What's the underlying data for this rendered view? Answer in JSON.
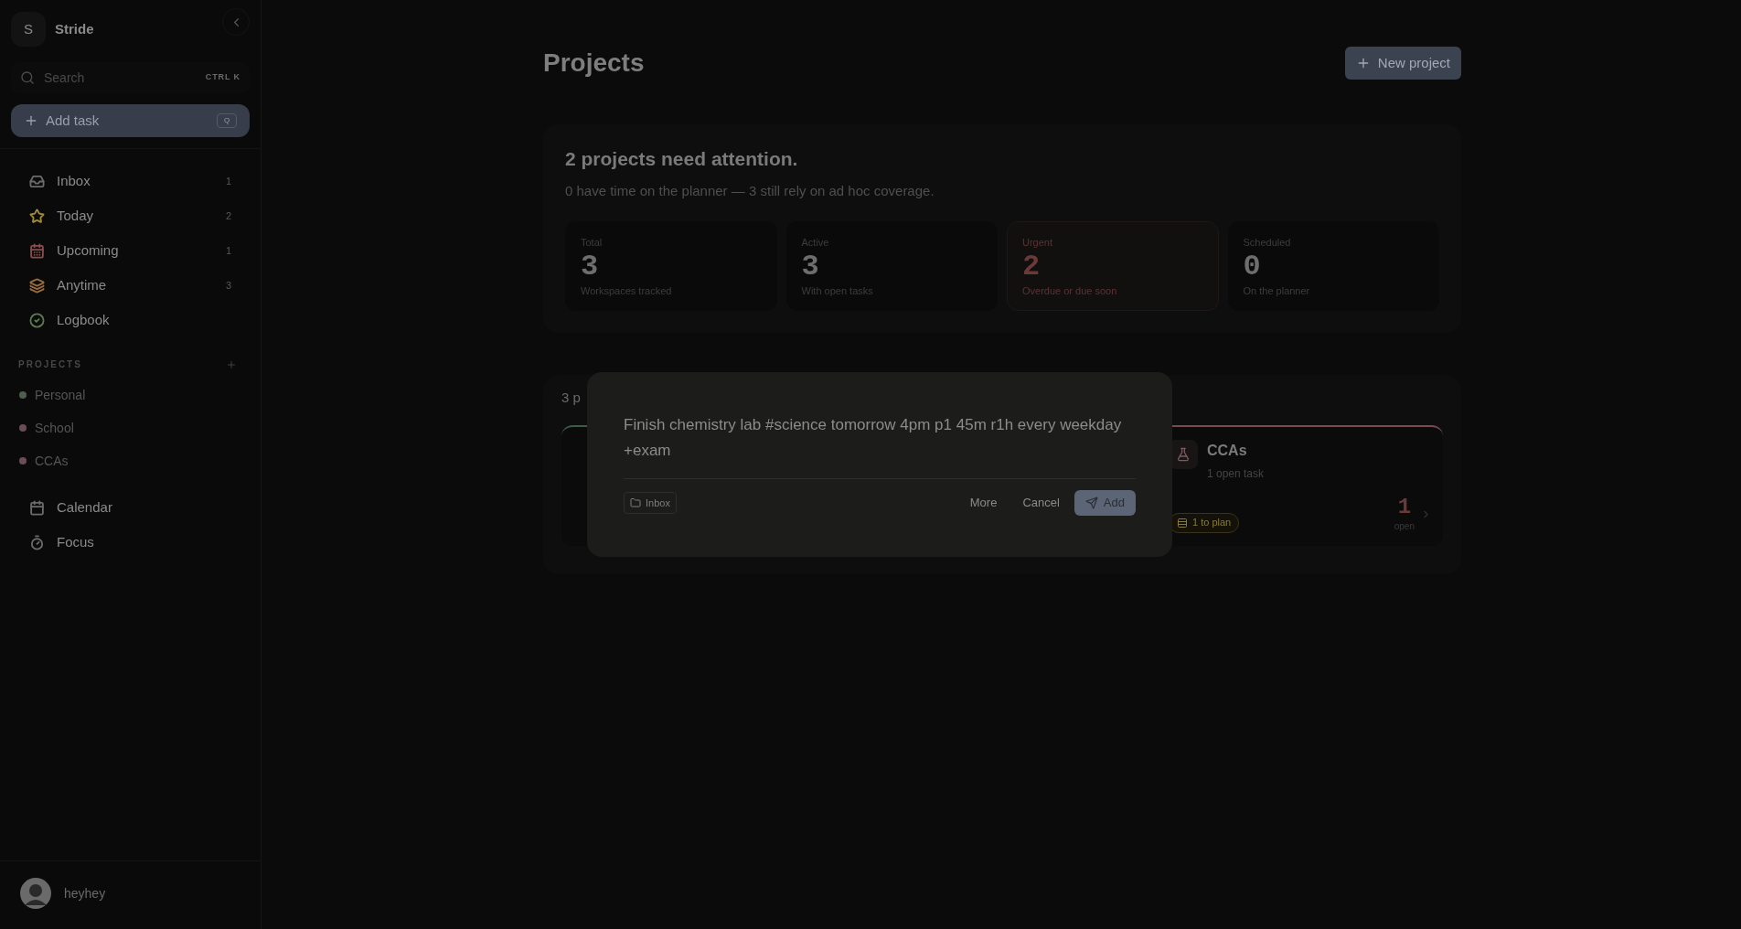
{
  "sidebar": {
    "app_initial": "S",
    "app_name": "Stride",
    "search": {
      "placeholder": "Search",
      "shortcut": "CTRL K"
    },
    "add_task": {
      "label": "Add task",
      "shortcut": "Q"
    },
    "nav": [
      {
        "kind": "inbox",
        "label": "Inbox",
        "count": "1",
        "color": "#6b6b6b"
      },
      {
        "kind": "today",
        "label": "Today",
        "count": "2",
        "color": "#a08a3a"
      },
      {
        "kind": "upcoming",
        "label": "Upcoming",
        "count": "1",
        "color": "#8a4c4c"
      },
      {
        "kind": "anytime",
        "label": "Anytime",
        "count": "3",
        "color": "#9a6a3a"
      },
      {
        "kind": "logbook",
        "label": "Logbook",
        "color": "#5a7a4e"
      }
    ],
    "projects_heading": "PROJECTS",
    "projects": [
      {
        "label": "Personal",
        "color": "#4d5e4f"
      },
      {
        "label": "School",
        "color": "#6b4d55"
      },
      {
        "label": "CCAs",
        "color": "#6b4d55"
      }
    ],
    "tools": [
      {
        "kind": "calendar",
        "label": "Calendar"
      },
      {
        "kind": "focus",
        "label": "Focus"
      }
    ],
    "user": {
      "name": "heyhey"
    }
  },
  "header": {
    "title": "Projects",
    "new_button": "New project"
  },
  "attention": {
    "headline": "2 projects need attention.",
    "subtitle": "0 have time on the planner — 3 still rely on ad hoc coverage.",
    "stats": [
      {
        "label": "Total",
        "value": "3",
        "caption": "Workspaces tracked",
        "urgent": false
      },
      {
        "label": "Active",
        "value": "3",
        "caption": "With open tasks",
        "urgent": false
      },
      {
        "label": "Urgent",
        "value": "2",
        "caption": "Overdue or due soon",
        "urgent": true
      },
      {
        "label": "Scheduled",
        "value": "0",
        "caption": "On the planner",
        "urgent": false
      }
    ]
  },
  "projects_panel": {
    "count_label": "3 p",
    "cards": [
      {
        "kind": "hidden",
        "color": "#3e5a48"
      },
      {
        "kind": "covered"
      },
      {
        "kind": "visible",
        "color": "#7a4a52",
        "name": "CCAs",
        "subtitle": "1 open task",
        "badge": "1 to plan",
        "number": "1",
        "number_caption": "open"
      }
    ]
  },
  "quick_add": {
    "text": "Finish chemistry lab #science tomorrow 4pm p1 45m r1h every weekday +exam",
    "project": "Inbox",
    "more": "More",
    "cancel": "Cancel",
    "add": "Add"
  }
}
